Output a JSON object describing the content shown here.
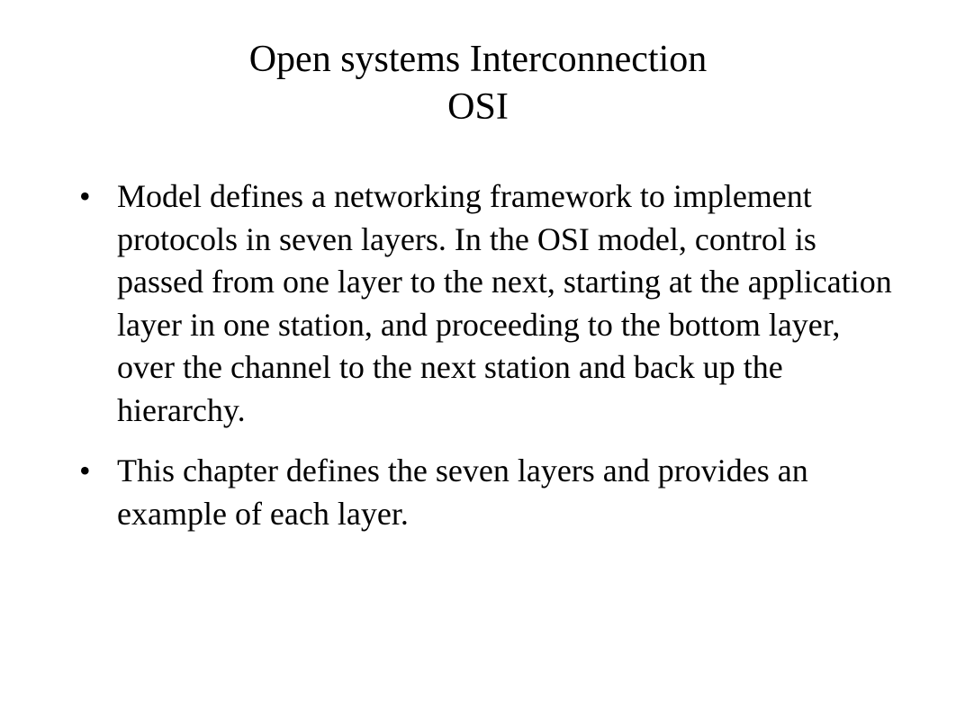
{
  "title": {
    "line1": "Open systems  Interconnection",
    "line2": "OSI"
  },
  "bullets": [
    "Model defines a networking framework to implement protocols in seven layers. In the OSI model, control is passed from one layer to the next, starting at the application layer in one station, and proceeding to the bottom layer, over the channel to the next station and back up the hierarchy.",
    "This chapter defines the seven layers and provides an example of each layer."
  ]
}
